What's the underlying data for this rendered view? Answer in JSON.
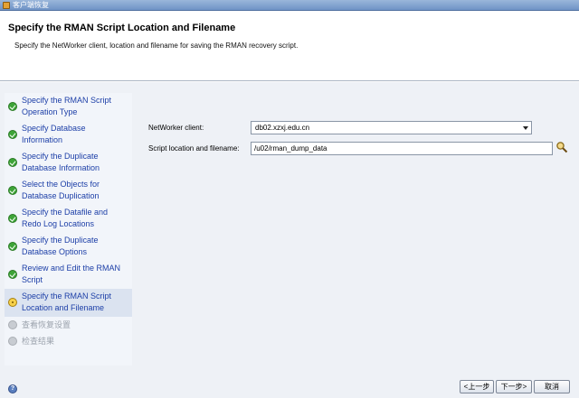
{
  "window": {
    "title": "客户端恢复"
  },
  "header": {
    "title": "Specify the RMAN Script Location and Filename",
    "description": "Specify the NetWorker client, location and filename for saving the RMAN recovery script."
  },
  "steps": [
    {
      "label": "Specify the RMAN Script Operation Type",
      "status": "done"
    },
    {
      "label": "Specify Database Information",
      "status": "done"
    },
    {
      "label": "Specify the Duplicate Database Information",
      "status": "done"
    },
    {
      "label": "Select the Objects for Database Duplication",
      "status": "done"
    },
    {
      "label": "Specify the Datafile and Redo Log Locations",
      "status": "done"
    },
    {
      "label": "Specify the Duplicate Database Options",
      "status": "done"
    },
    {
      "label": "Review and Edit the RMAN Script",
      "status": "done"
    },
    {
      "label": "Specify the RMAN Script Location and Filename",
      "status": "current"
    },
    {
      "label": "查看恢复设置",
      "status": "pending"
    },
    {
      "label": "检查结果",
      "status": "pending"
    }
  ],
  "form": {
    "client_label": "NetWorker client:",
    "client_value": "db02.xzxj.edu.cn",
    "location_label": "Script location and filename:",
    "location_value": "/u02/rman_dump_data"
  },
  "footer": {
    "help_icon": "help-icon",
    "back_label": "<上一步",
    "next_label": "下一步>",
    "cancel_label": "取消"
  },
  "colors": {
    "accent_link": "#1e40a8",
    "done": "#3ea438",
    "current": "#f7d14a"
  }
}
